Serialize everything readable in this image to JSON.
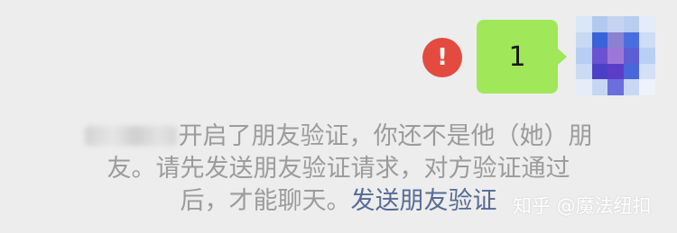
{
  "message": {
    "text": "1"
  },
  "error_badge": {
    "symbol": "!"
  },
  "avatar": {
    "icon": "pixelated-avatar"
  },
  "system_notice": {
    "line1_suffix": "开启了朋友验证，你还不是他（她）朋",
    "line2": "友。请先发送朋友验证请求，对方验证通过",
    "line3_prefix": "后，才能聊天。",
    "link_text": "发送朋友验证"
  },
  "watermark": {
    "text": "知乎 @魔法纽扣"
  },
  "colors": {
    "background": "#ededed",
    "bubble": "#a0e75a",
    "error": "#e34b41",
    "notice_text": "#9b9b9b",
    "link": "#576b95"
  }
}
